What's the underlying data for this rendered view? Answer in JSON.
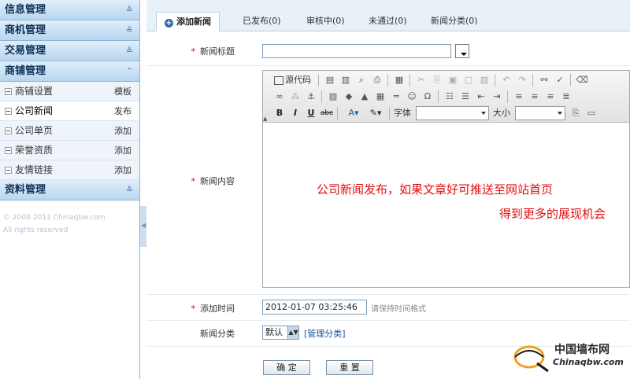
{
  "sidebar": {
    "sections": [
      {
        "label": "信息管理",
        "icon": "chevron-down-icon"
      },
      {
        "label": "商机管理",
        "icon": "chevron-down-icon"
      },
      {
        "label": "交易管理",
        "icon": "chevron-down-icon"
      },
      {
        "label": "商铺管理",
        "icon": "chevron-up-icon"
      },
      {
        "label": "资料管理",
        "icon": "chevron-down-icon"
      }
    ],
    "items": [
      {
        "label": "商铺设置",
        "action": "模板"
      },
      {
        "label": "公司新闻",
        "action": "发布"
      },
      {
        "label": "公司单页",
        "action": "添加"
      },
      {
        "label": "荣誉资质",
        "action": "添加"
      },
      {
        "label": "友情链接",
        "action": "添加"
      }
    ],
    "copyright_line1": "© 2008-2011 Chinaqbw.com",
    "copyright_line2": "All rights reserved"
  },
  "tabs": [
    {
      "label": "添加新闻"
    },
    {
      "label": "已发布(0)"
    },
    {
      "label": "审核中(0)"
    },
    {
      "label": "未通过(0)"
    },
    {
      "label": "新闻分类(0)"
    }
  ],
  "form": {
    "title_label": "新闻标题",
    "content_label": "新闻内容",
    "time_label": "添加时间",
    "category_label": "新闻分类",
    "required_mark": "*",
    "time_value": "2012-01-07 03:25:46",
    "time_hint": "请保持时间格式",
    "category_value": "默认",
    "manage_link": "[管理分类]",
    "submit_label": "确 定",
    "reset_label": "重 置"
  },
  "editor": {
    "source_label": "源代码",
    "font_label": "字体",
    "size_label": "大小",
    "content_line1": "公司新闻发布，如果文章好可推送至网站首页",
    "content_line2": "得到更多的展现机会"
  },
  "logo": {
    "cn": "中国墙布网",
    "en": "Chinaqbw.com"
  },
  "colors": {
    "accent": "#2f6aa8",
    "required": "#d40000",
    "highlight_text": "#e01010"
  }
}
